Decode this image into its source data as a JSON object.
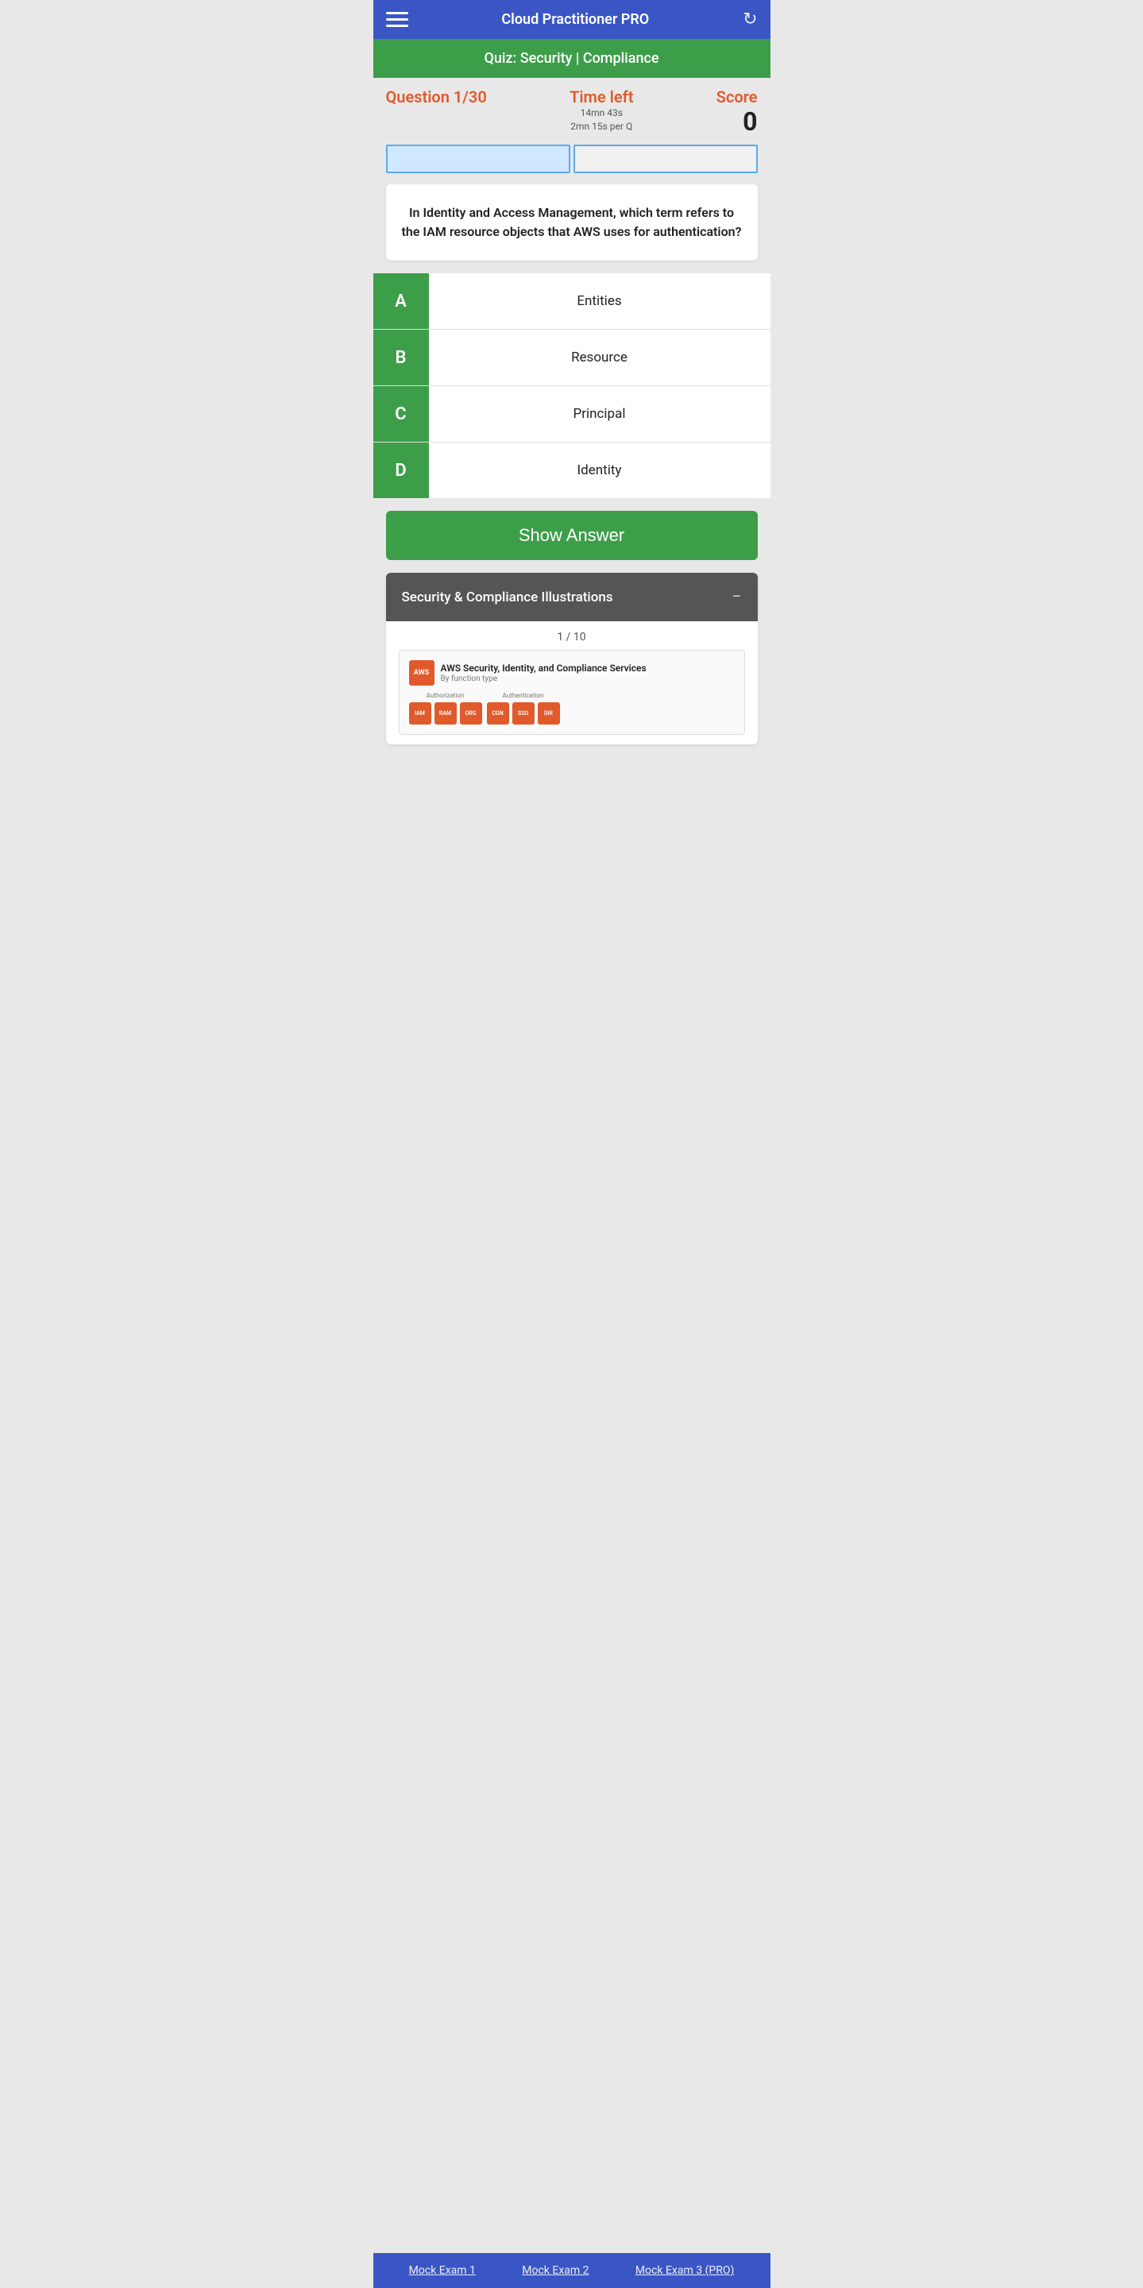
{
  "header": {
    "title": "Cloud Practitioner PRO",
    "refresh_label": "↻"
  },
  "quiz_title": "Quiz: Security | Compliance",
  "stats": {
    "question_label": "Question 1/30",
    "time_label": "Time left",
    "time_value": "14mn 43s",
    "time_per_q": "2mn 15s per Q",
    "score_label": "Score",
    "score_value": "0"
  },
  "progress": {
    "total_segments": 2,
    "filled_segments": 1
  },
  "question": {
    "text": "In Identity and Access Management, which term refers to the IAM resource objects that AWS uses for authentication?"
  },
  "options": [
    {
      "letter": "A",
      "text": "Entities"
    },
    {
      "letter": "B",
      "text": "Resource"
    },
    {
      "letter": "C",
      "text": "Principal"
    },
    {
      "letter": "D",
      "text": "Identity"
    }
  ],
  "show_answer_button": "Show Answer",
  "illustrations": {
    "title": "Security & Compliance Illustrations",
    "toggle": "−",
    "counter": "1 / 10",
    "preview_title": "AWS Security, Identity, and Compliance Services",
    "preview_subtitle": "By function type",
    "aws_icon_label": "AWS",
    "service_groups": [
      {
        "label": "Authorization",
        "services": [
          {
            "name": "IAM"
          },
          {
            "name": "AWS RAM"
          },
          {
            "name": "AWS Organizations"
          }
        ]
      },
      {
        "label": "Authentication",
        "services": [
          {
            "name": "Amazon Cognito"
          },
          {
            "name": "AWS SSO"
          },
          {
            "name": "Amazon Directory Service"
          }
        ]
      }
    ]
  },
  "bottom_nav": {
    "items": [
      {
        "label": "Mock Exam 1"
      },
      {
        "label": "Mock Exam 2"
      },
      {
        "label": "Mock Exam 3 (PRO)"
      }
    ]
  }
}
